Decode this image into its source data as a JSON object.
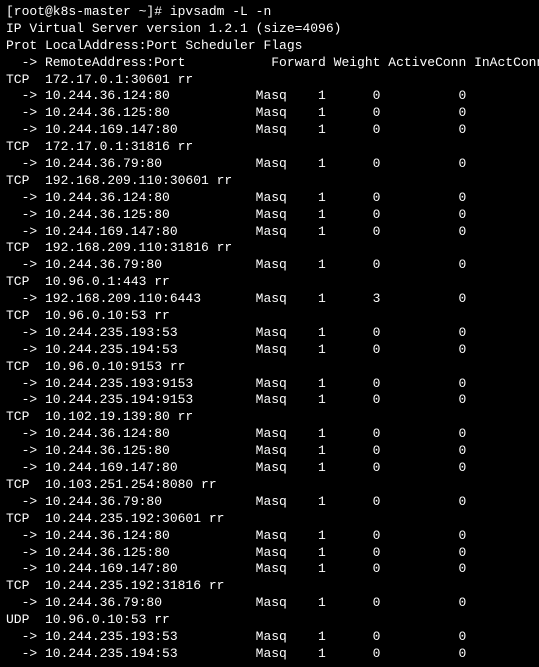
{
  "prompt": "[root@k8s-master ~]# ipvsadm -L -n",
  "header1": "IP Virtual Server version 1.2.1 (size=4096)",
  "header2": "Prot LocalAddress:Port Scheduler Flags",
  "header3": "  -> RemoteAddress:Port           Forward Weight ActiveConn InActConn",
  "services": [
    {
      "proto": "TCP",
      "addr": "172.17.0.1:30601",
      "sched": "rr",
      "reals": [
        {
          "addr": "10.244.36.124:80",
          "fwd": "Masq",
          "weight": "1",
          "active": "0",
          "inact": "0"
        },
        {
          "addr": "10.244.36.125:80",
          "fwd": "Masq",
          "weight": "1",
          "active": "0",
          "inact": "0"
        },
        {
          "addr": "10.244.169.147:80",
          "fwd": "Masq",
          "weight": "1",
          "active": "0",
          "inact": "0"
        }
      ]
    },
    {
      "proto": "TCP",
      "addr": "172.17.0.1:31816",
      "sched": "rr",
      "reals": [
        {
          "addr": "10.244.36.79:80",
          "fwd": "Masq",
          "weight": "1",
          "active": "0",
          "inact": "0"
        }
      ]
    },
    {
      "proto": "TCP",
      "addr": "192.168.209.110:30601",
      "sched": "rr",
      "reals": [
        {
          "addr": "10.244.36.124:80",
          "fwd": "Masq",
          "weight": "1",
          "active": "0",
          "inact": "0"
        },
        {
          "addr": "10.244.36.125:80",
          "fwd": "Masq",
          "weight": "1",
          "active": "0",
          "inact": "0"
        },
        {
          "addr": "10.244.169.147:80",
          "fwd": "Masq",
          "weight": "1",
          "active": "0",
          "inact": "0"
        }
      ]
    },
    {
      "proto": "TCP",
      "addr": "192.168.209.110:31816",
      "sched": "rr",
      "reals": [
        {
          "addr": "10.244.36.79:80",
          "fwd": "Masq",
          "weight": "1",
          "active": "0",
          "inact": "0"
        }
      ]
    },
    {
      "proto": "TCP",
      "addr": "10.96.0.1:443",
      "sched": "rr",
      "reals": [
        {
          "addr": "192.168.209.110:6443",
          "fwd": "Masq",
          "weight": "1",
          "active": "3",
          "inact": "0"
        }
      ]
    },
    {
      "proto": "TCP",
      "addr": "10.96.0.10:53",
      "sched": "rr",
      "reals": [
        {
          "addr": "10.244.235.193:53",
          "fwd": "Masq",
          "weight": "1",
          "active": "0",
          "inact": "0"
        },
        {
          "addr": "10.244.235.194:53",
          "fwd": "Masq",
          "weight": "1",
          "active": "0",
          "inact": "0"
        }
      ]
    },
    {
      "proto": "TCP",
      "addr": "10.96.0.10:9153",
      "sched": "rr",
      "reals": [
        {
          "addr": "10.244.235.193:9153",
          "fwd": "Masq",
          "weight": "1",
          "active": "0",
          "inact": "0"
        },
        {
          "addr": "10.244.235.194:9153",
          "fwd": "Masq",
          "weight": "1",
          "active": "0",
          "inact": "0"
        }
      ]
    },
    {
      "proto": "TCP",
      "addr": "10.102.19.139:80",
      "sched": "rr",
      "reals": [
        {
          "addr": "10.244.36.124:80",
          "fwd": "Masq",
          "weight": "1",
          "active": "0",
          "inact": "0"
        },
        {
          "addr": "10.244.36.125:80",
          "fwd": "Masq",
          "weight": "1",
          "active": "0",
          "inact": "0"
        },
        {
          "addr": "10.244.169.147:80",
          "fwd": "Masq",
          "weight": "1",
          "active": "0",
          "inact": "0"
        }
      ]
    },
    {
      "proto": "TCP",
      "addr": "10.103.251.254:8080",
      "sched": "rr",
      "reals": [
        {
          "addr": "10.244.36.79:80",
          "fwd": "Masq",
          "weight": "1",
          "active": "0",
          "inact": "0"
        }
      ]
    },
    {
      "proto": "TCP",
      "addr": "10.244.235.192:30601",
      "sched": "rr",
      "reals": [
        {
          "addr": "10.244.36.124:80",
          "fwd": "Masq",
          "weight": "1",
          "active": "0",
          "inact": "0"
        },
        {
          "addr": "10.244.36.125:80",
          "fwd": "Masq",
          "weight": "1",
          "active": "0",
          "inact": "0"
        },
        {
          "addr": "10.244.169.147:80",
          "fwd": "Masq",
          "weight": "1",
          "active": "0",
          "inact": "0"
        }
      ]
    },
    {
      "proto": "TCP",
      "addr": "10.244.235.192:31816",
      "sched": "rr",
      "reals": [
        {
          "addr": "10.244.36.79:80",
          "fwd": "Masq",
          "weight": "1",
          "active": "0",
          "inact": "0"
        }
      ]
    },
    {
      "proto": "UDP",
      "addr": "10.96.0.10:53",
      "sched": "rr",
      "reals": [
        {
          "addr": "10.244.235.193:53",
          "fwd": "Masq",
          "weight": "1",
          "active": "0",
          "inact": "0"
        },
        {
          "addr": "10.244.235.194:53",
          "fwd": "Masq",
          "weight": "1",
          "active": "0",
          "inact": "0"
        }
      ]
    }
  ]
}
